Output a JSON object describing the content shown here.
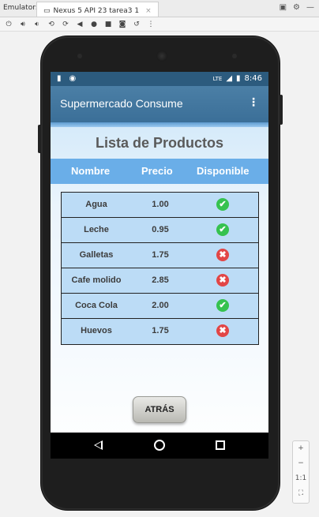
{
  "ide": {
    "emulator_label": "Emulator:",
    "tab_label": "Nexus 5 API 23 tarea3 1",
    "tab_close": "×"
  },
  "status": {
    "lte": "LTE",
    "time": "8:46"
  },
  "app": {
    "title": "Supermercado Consume",
    "overflow": "⋮",
    "page_title": "Lista de Productos",
    "headers": {
      "name": "Nombre",
      "price": "Precio",
      "available": "Disponible"
    },
    "products": [
      {
        "name": "Agua",
        "price": "1.00",
        "available": true
      },
      {
        "name": "Leche",
        "price": "0.95",
        "available": true
      },
      {
        "name": "Galletas",
        "price": "1.75",
        "available": false
      },
      {
        "name": "Cafe molido",
        "price": "2.85",
        "available": false
      },
      {
        "name": "Coca Cola",
        "price": "2.00",
        "available": true
      },
      {
        "name": "Huevos",
        "price": "1.75",
        "available": false
      }
    ],
    "back_button": "ATRÁS"
  },
  "zoom": {
    "plus": "+",
    "minus": "−",
    "one_to_one": "1:1"
  },
  "colors": {
    "action_bar": "#3b6f98",
    "header_band": "#6aaee8",
    "row_bg": "#bcdcf6",
    "available_yes": "#36c24f",
    "available_no": "#e24646"
  }
}
